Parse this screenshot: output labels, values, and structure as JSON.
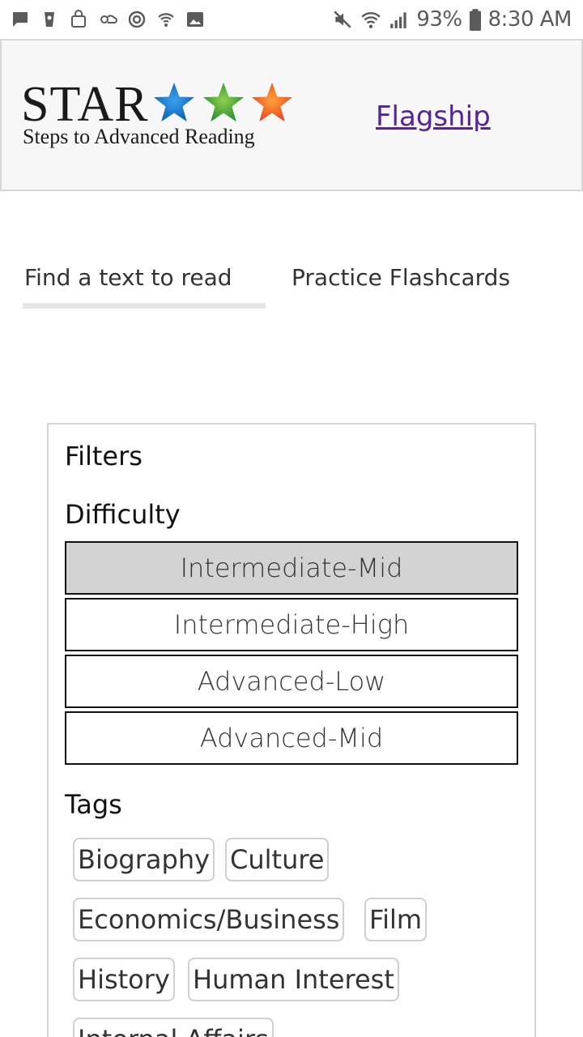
{
  "status_bar": {
    "left_icons": [
      "message-icon",
      "cup-icon",
      "bag-icon",
      "weather-icon",
      "sync-icon",
      "wifi-call-icon",
      "image-icon"
    ],
    "battery_percent": "93%",
    "time": "8:30 AM"
  },
  "header": {
    "logo_title": "STAR",
    "logo_subtitle": "Steps to Advanced Reading",
    "logo_star_colors": [
      "#0a6fc2",
      "#3fa33a",
      "#f0582a"
    ],
    "flagship_link": "Flagship",
    "link_color": "#55249b"
  },
  "tabs": [
    {
      "label": "Find a text to read",
      "active": true
    },
    {
      "label": "Practice Flashcards",
      "active": false
    }
  ],
  "filters": {
    "title": "Filters",
    "difficulty_title": "Difficulty",
    "difficulty_options": [
      {
        "label": "Intermediate-Mid",
        "selected": true
      },
      {
        "label": "Intermediate-High",
        "selected": false
      },
      {
        "label": "Advanced-Low",
        "selected": false
      },
      {
        "label": "Advanced-Mid",
        "selected": false
      }
    ],
    "tags_title": "Tags",
    "tags": [
      "Biography",
      "Culture",
      "Economics/Business",
      "Film",
      "History",
      "Human Interest",
      "Internal Affairs"
    ]
  }
}
